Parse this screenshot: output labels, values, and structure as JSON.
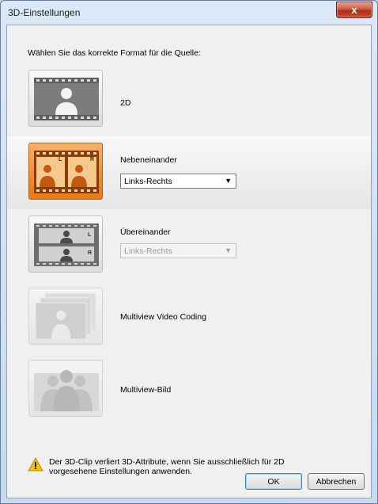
{
  "window": {
    "title": "3D-Einstellungen",
    "close_glyph": "x"
  },
  "prompt": "Wählen Sie das korrekte Format für die Quelle:",
  "options": [
    {
      "icon": "person-2d-icon",
      "label": "2D",
      "selected": false,
      "enabled": true
    },
    {
      "icon": "side-by-side-icon",
      "label": "Nebeneinander",
      "selected": true,
      "enabled": true,
      "dropdown": {
        "value": "Links-Rechts",
        "enabled": true
      },
      "marks": [
        "L",
        "R"
      ]
    },
    {
      "icon": "top-bottom-icon",
      "label": "Übereinander",
      "selected": false,
      "enabled": true,
      "dropdown": {
        "value": "Links-Rechts",
        "enabled": false
      },
      "marks": [
        "L",
        "R"
      ]
    },
    {
      "icon": "multiview-video-coding-icon",
      "label": "Multiview Video Coding",
      "selected": false,
      "enabled": false
    },
    {
      "icon": "multiview-image-icon",
      "label": "Multiview-Bild",
      "selected": false,
      "enabled": false
    }
  ],
  "warning": {
    "icon": "warning-icon",
    "text": "Der 3D-Clip verliert 3D-Attribute, wenn Sie ausschließlich für 2D vorgesehene Einstellungen anwenden."
  },
  "buttons": {
    "ok": "OK",
    "cancel": "Abbrechen"
  },
  "colors": {
    "accent": "#ee8c2f",
    "titlebar": "#c6d9ef",
    "close": "#c94d34",
    "warning": "#f5c400"
  }
}
